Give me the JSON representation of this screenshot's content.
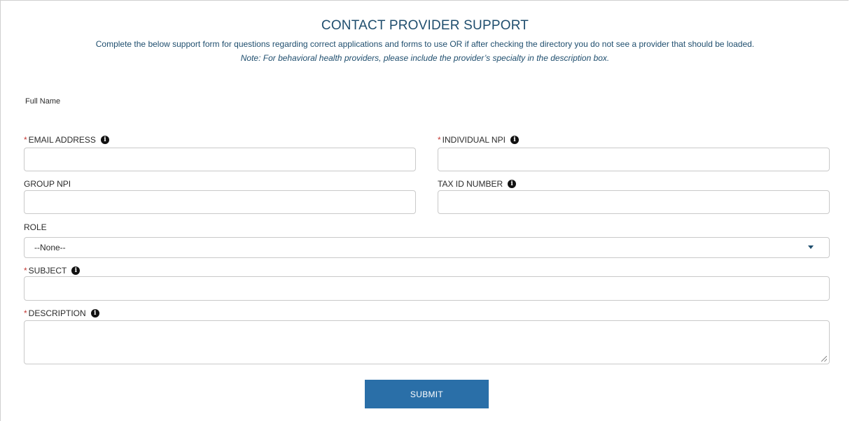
{
  "header": {
    "title": "CONTACT PROVIDER SUPPORT",
    "intro": "Complete the below support form for questions regarding correct applications and forms to use OR if after checking the directory you do not see a provider that should be loaded.",
    "note": "Note: For behavioral health providers, please include the provider’s specialty in the description box."
  },
  "form": {
    "full_name_label": "Full Name",
    "required_marker": "*",
    "info_glyph": "i",
    "email_label": "EMAIL ADDRESS",
    "email_value": "",
    "individual_npi_label": "INDIVIDUAL NPI",
    "individual_npi_value": "",
    "group_npi_label": "GROUP NPI",
    "group_npi_value": "",
    "tax_id_label": "TAX ID NUMBER",
    "tax_id_value": "",
    "role_label": "ROLE",
    "role_selected": "--None--",
    "subject_label": "SUBJECT",
    "subject_value": "",
    "description_label": "DESCRIPTION",
    "description_value": "",
    "submit_label": "SUBMIT"
  },
  "colors": {
    "heading": "#1f4e6e",
    "required": "#c23934",
    "button": "#2a6fa8",
    "border": "#c9c9c9"
  },
  "icons": [
    "info-icon",
    "chevron-down-icon",
    "resize-handle-icon"
  ]
}
